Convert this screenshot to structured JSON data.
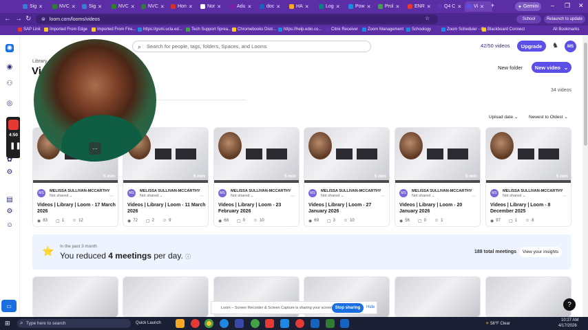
{
  "browser": {
    "tabs": [
      {
        "label": "Sig",
        "color": "#3a7bd5"
      },
      {
        "label": "NVC",
        "color": "#2e7d32"
      },
      {
        "label": "Sig",
        "color": "#3a7bd5"
      },
      {
        "label": "NVC",
        "color": "#2e7d32"
      },
      {
        "label": "NVC",
        "color": "#2e7d32"
      },
      {
        "label": "Hon",
        "color": "#d32f2f"
      },
      {
        "label": "Nor",
        "color": "#ffffff"
      },
      {
        "label": "Adu",
        "color": "#7b1fa2"
      },
      {
        "label": "doc",
        "color": "#1565c0"
      },
      {
        "label": "HA",
        "color": "#f9a825"
      },
      {
        "label": "Log",
        "color": "#00897b"
      },
      {
        "label": "Pow",
        "color": "#1e88e5"
      },
      {
        "label": "Prol",
        "color": "#43a047"
      },
      {
        "label": "ENR",
        "color": "#e53935"
      },
      {
        "label": "Q4 C",
        "color": "#5e35b1"
      },
      {
        "label": "Vi",
        "color": "#5b4fe8"
      }
    ],
    "gemini_label": "Gemini",
    "url": "loom.com/looms/videos",
    "profile_label": "School",
    "relaunch_label": "Relaunch to update",
    "bookmarks": [
      {
        "label": "SAP Link",
        "color": "#e53935"
      },
      {
        "label": "Imported From Edge",
        "color": "#ffca28"
      },
      {
        "label": "Imported From Fire...",
        "color": "#ffca28"
      },
      {
        "label": "https://gsmi.ucla.ed...",
        "color": "#1e88e5"
      },
      {
        "label": "Tech Support Sprea...",
        "color": "#43a047"
      },
      {
        "label": "Chromebooks Distr...",
        "color": "#ffca28"
      },
      {
        "label": "https://help.edio.co...",
        "color": "#1e88e5"
      },
      {
        "label": "Citrix Receiver",
        "color": "#5e35b1"
      },
      {
        "label": "Zoom Management",
        "color": "#1e88e5"
      },
      {
        "label": "Schoology",
        "color": "#1e88e5"
      },
      {
        "label": "Zoom Scheduler - C...",
        "color": "#1e88e5"
      },
      {
        "label": "Blackboard Connect",
        "color": "#ffca28"
      }
    ],
    "all_bookmarks_label": "All Bookmarks"
  },
  "app": {
    "search_placeholder": "Search for people, tags, folders, Spaces, and Looms",
    "video_limit": "42/50 videos",
    "upgrade_label": "Upgrade",
    "avatar_initials": "MS",
    "breadcrumb": "Library",
    "page_title": "Vi",
    "new_folder_label": "New folder",
    "new_video_label": "New video",
    "video_count": "34 videos",
    "sort_date_label": "Upload date",
    "sort_order_label": "Newest to Oldest",
    "recorder_time": "4:50"
  },
  "videos": [
    {
      "duration": "5 min",
      "owner": "MELISSA SULLIVAN-MCCARTHY",
      "shared": "Not shared",
      "title": "Videos | Library | Loom - 17 March 2026",
      "views": "83",
      "comments": "1",
      "reactions": "12"
    },
    {
      "duration": "5 min",
      "owner": "MELISSA SULLIVAN-MCCARTHY",
      "shared": "Not shared",
      "title": "Videos | Library | Loom - 11 March 2026",
      "views": "72",
      "comments": "2",
      "reactions": "9"
    },
    {
      "duration": "5 min",
      "owner": "MELISSA SULLIVAN-MCCARTHY",
      "shared": "Not shared",
      "title": "Videos | Library | Loom - 23 February 2026",
      "views": "68",
      "comments": "0",
      "reactions": "10"
    },
    {
      "duration": "5 min",
      "owner": "MELISSA SULLIVAN-MCCARTHY",
      "shared": "Not shared",
      "title": "Videos | Library | Loom - 27 January 2026",
      "views": "69",
      "comments": "3",
      "reactions": "10"
    },
    {
      "duration": "5 min",
      "owner": "MELISSA SULLIVAN-MCCARTHY",
      "shared": "Not shared",
      "title": "Videos | Library | Loom - 20 January 2026",
      "views": "56",
      "comments": "0",
      "reactions": "1"
    },
    {
      "duration": "5 min",
      "owner": "MELISSA SULLIVAN-MCCARTHY",
      "shared": "Not shared",
      "title": "Videos | Library | Loom - 8 December 2025",
      "views": "97",
      "comments": "1",
      "reactions": "8"
    }
  ],
  "insights": {
    "period": "In the past 3 month",
    "prefix": "You reduced ",
    "highlight": "4 meetings",
    "suffix": " per day.",
    "total_meetings": "188 total meetings",
    "view_insights_label": "View your insights"
  },
  "sharing_bar": {
    "text": "Loom – Screen Recorder & Screen Capture is sharing your screen.",
    "stop_label": "Stop sharing",
    "hide_label": "Hide"
  },
  "taskbar": {
    "search_placeholder": "Type here to search",
    "quick_launch": "Quick Launch",
    "weather": "58°F Clear",
    "time": "10:27 AM",
    "date": "4/17/2026"
  }
}
